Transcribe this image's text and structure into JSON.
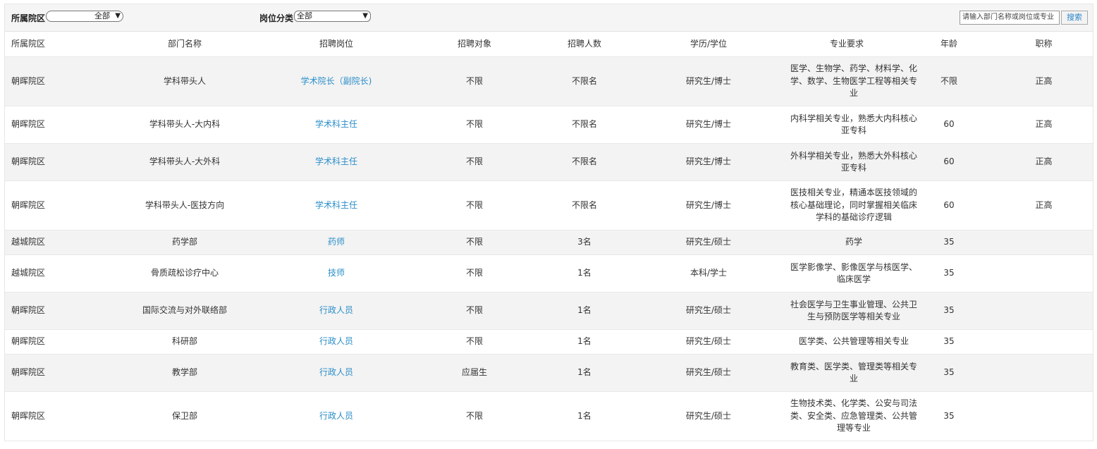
{
  "filters": {
    "district_label": "所属院区",
    "district_value": "全部",
    "category_label": "岗位分类",
    "category_value": "全部",
    "search_placeholder": "请输入部门名称或岗位或专业",
    "search_button": "搜索"
  },
  "columns": [
    "所属院区",
    "部门名称",
    "招聘岗位",
    "招聘对象",
    "招聘人数",
    "学历/学位",
    "专业要求",
    "年龄",
    "职称"
  ],
  "rows": [
    {
      "district": "朝晖院区",
      "dept": "学科带头人",
      "post": "学术院长（副院长)",
      "target": "不限",
      "count": "不限名",
      "degree": "研究生/博士",
      "major": "医学、生物学、药学、材料学、化学、数学、生物医学工程等相关专业",
      "age": "不限",
      "title": "正高"
    },
    {
      "district": "朝晖院区",
      "dept": "学科带头人-大内科",
      "post": "学术科主任",
      "target": "不限",
      "count": "不限名",
      "degree": "研究生/博士",
      "major": "内科学相关专业，熟悉大内科核心亚专科",
      "age": "60",
      "title": "正高"
    },
    {
      "district": "朝晖院区",
      "dept": "学科带头人-大外科",
      "post": "学术科主任",
      "target": "不限",
      "count": "不限名",
      "degree": "研究生/博士",
      "major": "外科学相关专业，熟悉大外科核心亚专科",
      "age": "60",
      "title": "正高"
    },
    {
      "district": "朝晖院区",
      "dept": "学科带头人-医技方向",
      "post": "学术科主任",
      "target": "不限",
      "count": "不限名",
      "degree": "研究生/博士",
      "major": "医技相关专业，精通本医技领域的核心基础理论，同时掌握相关临床学科的基础诊疗逻辑",
      "age": "60",
      "title": "正高"
    },
    {
      "district": "越城院区",
      "dept": "药学部",
      "post": "药师",
      "target": "不限",
      "count": "3名",
      "degree": "研究生/硕士",
      "major": "药学",
      "age": "35",
      "title": ""
    },
    {
      "district": "越城院区",
      "dept": "骨质疏松诊疗中心",
      "post": "技师",
      "target": "不限",
      "count": "1名",
      "degree": "本科/学士",
      "major": "医学影像学、影像医学与核医学、临床医学",
      "age": "35",
      "title": ""
    },
    {
      "district": "朝晖院区",
      "dept": "国际交流与对外联络部",
      "post": "行政人员",
      "target": "不限",
      "count": "1名",
      "degree": "研究生/硕士",
      "major": "社会医学与卫生事业管理、公共卫生与预防医学等相关专业",
      "age": "35",
      "title": ""
    },
    {
      "district": "朝晖院区",
      "dept": "科研部",
      "post": "行政人员",
      "target": "不限",
      "count": "1名",
      "degree": "研究生/硕士",
      "major": "医学类、公共管理等相关专业",
      "age": "35",
      "title": ""
    },
    {
      "district": "朝晖院区",
      "dept": "教学部",
      "post": "行政人员",
      "target": "应届生",
      "count": "1名",
      "degree": "研究生/硕士",
      "major": "教育类、医学类、管理类等相关专业",
      "age": "35",
      "title": ""
    },
    {
      "district": "朝晖院区",
      "dept": "保卫部",
      "post": "行政人员",
      "target": "不限",
      "count": "1名",
      "degree": "研究生/硕士",
      "major": "生物技术类、化学类、公安与司法类、安全类、应急管理类、公共管理等专业",
      "age": "35",
      "title": ""
    }
  ]
}
